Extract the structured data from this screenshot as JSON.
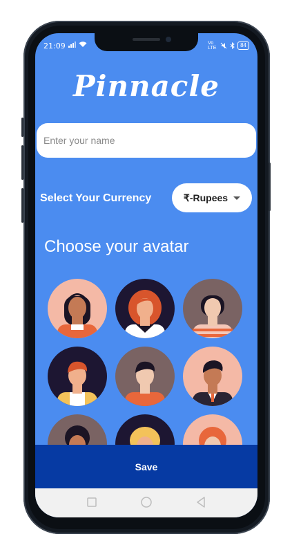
{
  "status_bar": {
    "time": "21:09",
    "right_label": "Vo LTE",
    "battery": "84",
    "icons": [
      "signal-icon",
      "wifi-icon",
      "mute-icon",
      "bluetooth-icon",
      "battery-icon"
    ]
  },
  "app": {
    "title": "Pinnacle"
  },
  "name_field": {
    "placeholder": "Enter your name",
    "value": ""
  },
  "currency": {
    "label": "Select Your Currency",
    "selected": "₹-Rupees"
  },
  "avatars": {
    "heading": "Choose your avatar",
    "items": [
      {
        "name": "avatar-1",
        "bg": "#f4b9a6"
      },
      {
        "name": "avatar-2",
        "bg": "#1d1632"
      },
      {
        "name": "avatar-3",
        "bg": "#7a6363"
      },
      {
        "name": "avatar-4",
        "bg": "#1d1632"
      },
      {
        "name": "avatar-5",
        "bg": "#7a6363"
      },
      {
        "name": "avatar-6",
        "bg": "#f4b9a6"
      },
      {
        "name": "avatar-7",
        "bg": "#7a6363"
      },
      {
        "name": "avatar-8",
        "bg": "#1d1632"
      },
      {
        "name": "avatar-9",
        "bg": "#f4b9a6"
      }
    ]
  },
  "actions": {
    "save_label": "Save"
  },
  "navigation": [
    "square-nav-icon",
    "circle-nav-icon",
    "back-nav-icon"
  ],
  "colors": {
    "primary": "#4b8cf0",
    "save_bar": "#063aa3"
  }
}
